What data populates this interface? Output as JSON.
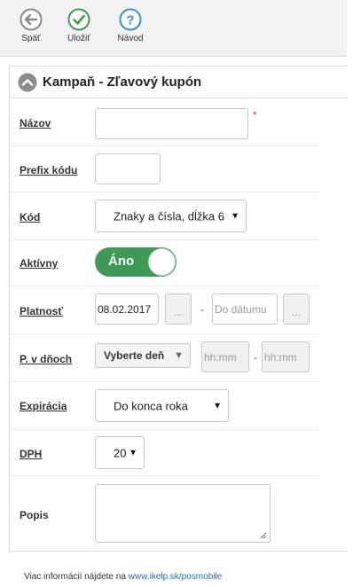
{
  "toolbar": {
    "back_label": "Späť",
    "save_label": "Uložiť",
    "help_label": "Návod",
    "colors": {
      "back": "#8a8a8a",
      "save": "#3f9a58",
      "help": "#3b8fd0"
    }
  },
  "panel": {
    "title": "Kampaň - Zľavový kupón"
  },
  "form": {
    "nazov": {
      "label": "Názov",
      "value": "",
      "required_mark": "*"
    },
    "prefix": {
      "label": "Prefix kódu",
      "value": ""
    },
    "kod": {
      "label": "Kód",
      "selected": "Znaky a čísla, dĺžka 6"
    },
    "aktivny": {
      "label": "Aktívny",
      "toggle_text": "Áno",
      "on": true
    },
    "platnost": {
      "label": "Platnosť",
      "from_value": "08.02.2017",
      "from_button": "...",
      "separator": "-",
      "to_placeholder": "Do dátumu",
      "to_button": "..."
    },
    "p_v_dnoch": {
      "label": "P. v dňoch",
      "day_select": "Vyberte deň",
      "time_from_placeholder": "hh:mm",
      "separator": "-",
      "time_to_placeholder": "hh:mm"
    },
    "expiracia": {
      "label": "Expirácia",
      "selected": "Do konca roka"
    },
    "dph": {
      "label": "DPH",
      "selected": "20"
    },
    "popis": {
      "label": "Popis",
      "value": ""
    }
  },
  "footer": {
    "text": "Viac informácií nájdete na ",
    "link_text": "www.ikelp.sk/posmobile"
  }
}
